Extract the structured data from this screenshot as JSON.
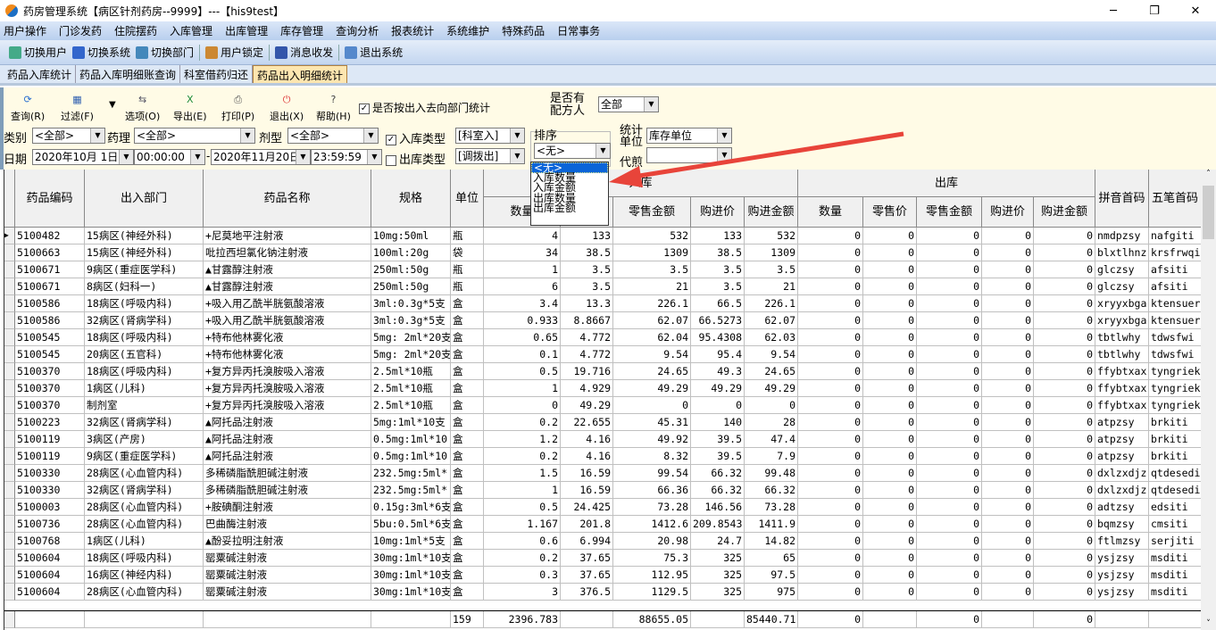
{
  "window": {
    "title": "药房管理系统【病区针剂药房--9999】---【his9test】",
    "min": "─",
    "max": "❐",
    "close": "✕"
  },
  "menu": [
    "用户操作",
    "门诊发药",
    "住院摆药",
    "入库管理",
    "出库管理",
    "库存管理",
    "查询分析",
    "报表统计",
    "系统维护",
    "特殊药品",
    "日常事务"
  ],
  "toolbar": [
    {
      "label": "切换用户",
      "icon": "users-icon"
    },
    {
      "label": "切换系统",
      "icon": "switch-icon"
    },
    {
      "label": "切换部门",
      "icon": "dept-icon"
    },
    {
      "label": "用户锁定",
      "icon": "lock-icon"
    },
    {
      "label": "消息收发",
      "icon": "info-icon"
    },
    {
      "label": "退出系统",
      "icon": "exit-icon"
    }
  ],
  "tabs": [
    "药品入库统计",
    "药品入库明细账查询",
    "科室借药归还",
    "药品出入明细统计"
  ],
  "active_tab": 3,
  "actions": [
    {
      "label": "查询(R)",
      "icon": "refresh-icon"
    },
    {
      "label": "过滤(F)",
      "icon": "filter-icon"
    },
    {
      "label": "选项(O)",
      "icon": "options-icon"
    },
    {
      "label": "导出(E)",
      "icon": "excel-icon"
    },
    {
      "label": "打印(P)",
      "icon": "print-icon"
    },
    {
      "label": "退出(X)",
      "icon": "power-icon"
    },
    {
      "label": "帮助(H)",
      "icon": "help-icon"
    }
  ],
  "filters": {
    "by_dept_label": "是否按出入去向部门统计",
    "by_dept_checked": true,
    "prescriber_label": "是否有配方人",
    "prescriber_value": "全部",
    "category_label": "类别",
    "category_value": "<全部>",
    "pharm_label": "药理",
    "pharm_value": "<全部>",
    "form_label": "剂型",
    "form_value": "<全部>",
    "in_type_label": "入库类型",
    "in_type_checked": true,
    "in_type_value": "[科室入]",
    "out_type_label": "出库类型",
    "out_type_checked": false,
    "out_type_value": "[调拨出]",
    "date_label": "日期",
    "date_from": "2020年10月 1日",
    "time_from": "00:00:00",
    "date_to": "2020年11月20日",
    "time_to": "23:59:59",
    "sort_label": "排序",
    "sort_value": "<无>",
    "sort_options": [
      "<无>",
      "入库数量",
      "入库金额",
      "出库数量",
      "出库金额"
    ],
    "unit_label": "统计单位",
    "unit_value": "库存单位",
    "agent_label": "代煎",
    "agent_value": ""
  },
  "table": {
    "headers": {
      "code": "药品编码",
      "dept": "出入部门",
      "name": "药品名称",
      "spec": "规格",
      "unit": "单位",
      "in_group": "入库",
      "out_group": "出库",
      "in_qty": "数量",
      "in_retail_amt": "零售金额",
      "in_cost": "购进价",
      "in_cost_amt": "购进金额",
      "out_qty": "数量",
      "out_retail": "零售价",
      "out_retail_amt": "零售金额",
      "out_cost": "购进价",
      "out_cost_amt": "购进金额",
      "py": "拼音首码",
      "wb": "五笔首码"
    },
    "rows": [
      [
        "5100482",
        "15病区(神经外科)",
        "+尼莫地平注射液",
        "10mg:50ml",
        "瓶",
        "4",
        "133",
        "532",
        "133",
        "532",
        "0",
        "0",
        "0",
        "0",
        "0",
        "nmdpzsy",
        "nafgiti"
      ],
      [
        "5100663",
        "15病区(神经外科)",
        "吡拉西坦氯化钠注射液",
        "100ml:20g",
        "袋",
        "34",
        "38.5",
        "1309",
        "38.5",
        "1309",
        "0",
        "0",
        "0",
        "0",
        "0",
        "blxtlhnz",
        "krsfrwqi"
      ],
      [
        "5100671",
        "9病区(重症医学科)",
        "▲甘露醇注射液",
        "250ml:50g",
        "瓶",
        "1",
        "3.5",
        "3.5",
        "3.5",
        "3.5",
        "0",
        "0",
        "0",
        "0",
        "0",
        "glczsy",
        "afsiti"
      ],
      [
        "5100671",
        "8病区(妇科一)",
        "▲甘露醇注射液",
        "250ml:50g",
        "瓶",
        "6",
        "3.5",
        "21",
        "3.5",
        "21",
        "0",
        "0",
        "0",
        "0",
        "0",
        "glczsy",
        "afsiti"
      ],
      [
        "5100586",
        "18病区(呼吸内科)",
        "+吸入用乙酰半胱氨酸溶液",
        "3ml:0.3g*5支",
        "盒",
        "3.4",
        "13.3",
        "226.1",
        "66.5",
        "226.1",
        "0",
        "0",
        "0",
        "0",
        "0",
        "xryyxbga",
        "ktensuer"
      ],
      [
        "5100586",
        "32病区(肾病学科)",
        "+吸入用乙酰半胱氨酸溶液",
        "3ml:0.3g*5支",
        "盒",
        "0.933",
        "8.8667",
        "62.07",
        "66.5273",
        "62.07",
        "0",
        "0",
        "0",
        "0",
        "0",
        "xryyxbga",
        "ktensuer"
      ],
      [
        "5100545",
        "18病区(呼吸内科)",
        "+特布他林雾化液",
        "5mg: 2ml*20支",
        "盒",
        "0.65",
        "4.772",
        "62.04",
        "95.4308",
        "62.03",
        "0",
        "0",
        "0",
        "0",
        "0",
        "tbtlwhy",
        "tdwsfwi"
      ],
      [
        "5100545",
        "20病区(五官科)",
        "+特布他林雾化液",
        "5mg: 2ml*20支",
        "盒",
        "0.1",
        "4.772",
        "9.54",
        "95.4",
        "9.54",
        "0",
        "0",
        "0",
        "0",
        "0",
        "tbtlwhy",
        "tdwsfwi"
      ],
      [
        "5100370",
        "18病区(呼吸内科)",
        "+复方异丙托溴胺吸入溶液",
        "2.5ml*10瓶",
        "盒",
        "0.5",
        "19.716",
        "24.65",
        "49.3",
        "24.65",
        "0",
        "0",
        "0",
        "0",
        "0",
        "ffybtxax",
        "tyngriek"
      ],
      [
        "5100370",
        "1病区(儿科)",
        "+复方异丙托溴胺吸入溶液",
        "2.5ml*10瓶",
        "盒",
        "1",
        "4.929",
        "49.29",
        "49.29",
        "49.29",
        "0",
        "0",
        "0",
        "0",
        "0",
        "ffybtxax",
        "tyngriek"
      ],
      [
        "5100370",
        "制剂室",
        "+复方异丙托溴胺吸入溶液",
        "2.5ml*10瓶",
        "盒",
        "0",
        "49.29",
        "0",
        "0",
        "0",
        "0",
        "0",
        "0",
        "0",
        "0",
        "ffybtxax",
        "tyngriek"
      ],
      [
        "5100223",
        "32病区(肾病学科)",
        "▲阿托品注射液",
        "5mg:1ml*10支",
        "盒",
        "0.2",
        "22.655",
        "45.31",
        "140",
        "28",
        "0",
        "0",
        "0",
        "0",
        "0",
        "atpzsy",
        "brkiti"
      ],
      [
        "5100119",
        "3病区(产房)",
        "▲阿托品注射液",
        "0.5mg:1ml*10",
        "盒",
        "1.2",
        "4.16",
        "49.92",
        "39.5",
        "47.4",
        "0",
        "0",
        "0",
        "0",
        "0",
        "atpzsy",
        "brkiti"
      ],
      [
        "5100119",
        "9病区(重症医学科)",
        "▲阿托品注射液",
        "0.5mg:1ml*10",
        "盒",
        "0.2",
        "4.16",
        "8.32",
        "39.5",
        "7.9",
        "0",
        "0",
        "0",
        "0",
        "0",
        "atpzsy",
        "brkiti"
      ],
      [
        "5100330",
        "28病区(心血管内科)",
        "多稀磷脂酰胆碱注射液",
        "232.5mg:5ml*",
        "盒",
        "1.5",
        "16.59",
        "99.54",
        "66.32",
        "99.48",
        "0",
        "0",
        "0",
        "0",
        "0",
        "dxlzxdjz",
        "qtdesedi"
      ],
      [
        "5100330",
        "32病区(肾病学科)",
        "多稀磷脂酰胆碱注射液",
        "232.5mg:5ml*",
        "盒",
        "1",
        "16.59",
        "66.36",
        "66.32",
        "66.32",
        "0",
        "0",
        "0",
        "0",
        "0",
        "dxlzxdjz",
        "qtdesedi"
      ],
      [
        "5100003",
        "28病区(心血管内科)",
        "+胺碘酮注射液",
        "0.15g:3ml*6支",
        "盒",
        "0.5",
        "24.425",
        "73.28",
        "146.56",
        "73.28",
        "0",
        "0",
        "0",
        "0",
        "0",
        "adtzsy",
        "edsiti"
      ],
      [
        "5100736",
        "28病区(心血管内科)",
        "巴曲酶注射液",
        "5bu:0.5ml*6支",
        "盒",
        "1.167",
        "201.8",
        "1412.6",
        "209.8543",
        "1411.9",
        "0",
        "0",
        "0",
        "0",
        "0",
        "bqmzsy",
        "cmsiti"
      ],
      [
        "5100768",
        "1病区(儿科)",
        "▲酚妥拉明注射液",
        "10mg:1ml*5支",
        "盒",
        "0.6",
        "6.994",
        "20.98",
        "24.7",
        "14.82",
        "0",
        "0",
        "0",
        "0",
        "0",
        "ftlmzsy",
        "serjiti"
      ],
      [
        "5100604",
        "18病区(呼吸内科)",
        "罂粟碱注射液",
        "30mg:1ml*10支",
        "盒",
        "0.2",
        "37.65",
        "75.3",
        "325",
        "65",
        "0",
        "0",
        "0",
        "0",
        "0",
        "ysjzsy",
        "msditi"
      ],
      [
        "5100604",
        "16病区(神经内科)",
        "罂粟碱注射液",
        "30mg:1ml*10支",
        "盒",
        "0.3",
        "37.65",
        "112.95",
        "325",
        "97.5",
        "0",
        "0",
        "0",
        "0",
        "0",
        "ysjzsy",
        "msditi"
      ],
      [
        "5100604",
        "28病区(心血管内科)",
        "罂粟碱注射液",
        "30mg:1ml*10支",
        "盒",
        "3",
        "376.5",
        "1129.5",
        "325",
        "975",
        "0",
        "0",
        "0",
        "0",
        "0",
        "ysjzsy",
        "msditi"
      ]
    ],
    "totals": [
      "",
      "",
      "",
      "",
      "159",
      "2396.783",
      "",
      "88655.05",
      "",
      "85440.71",
      "0",
      "",
      "0",
      "",
      "0",
      "",
      ""
    ]
  },
  "colors": {
    "menu_bg": "#c3d6f0",
    "panel_bg": "#fffbe6",
    "active_tab": "#fde6b0",
    "arrow": "#e8443a",
    "selection": "#0a64d8"
  }
}
